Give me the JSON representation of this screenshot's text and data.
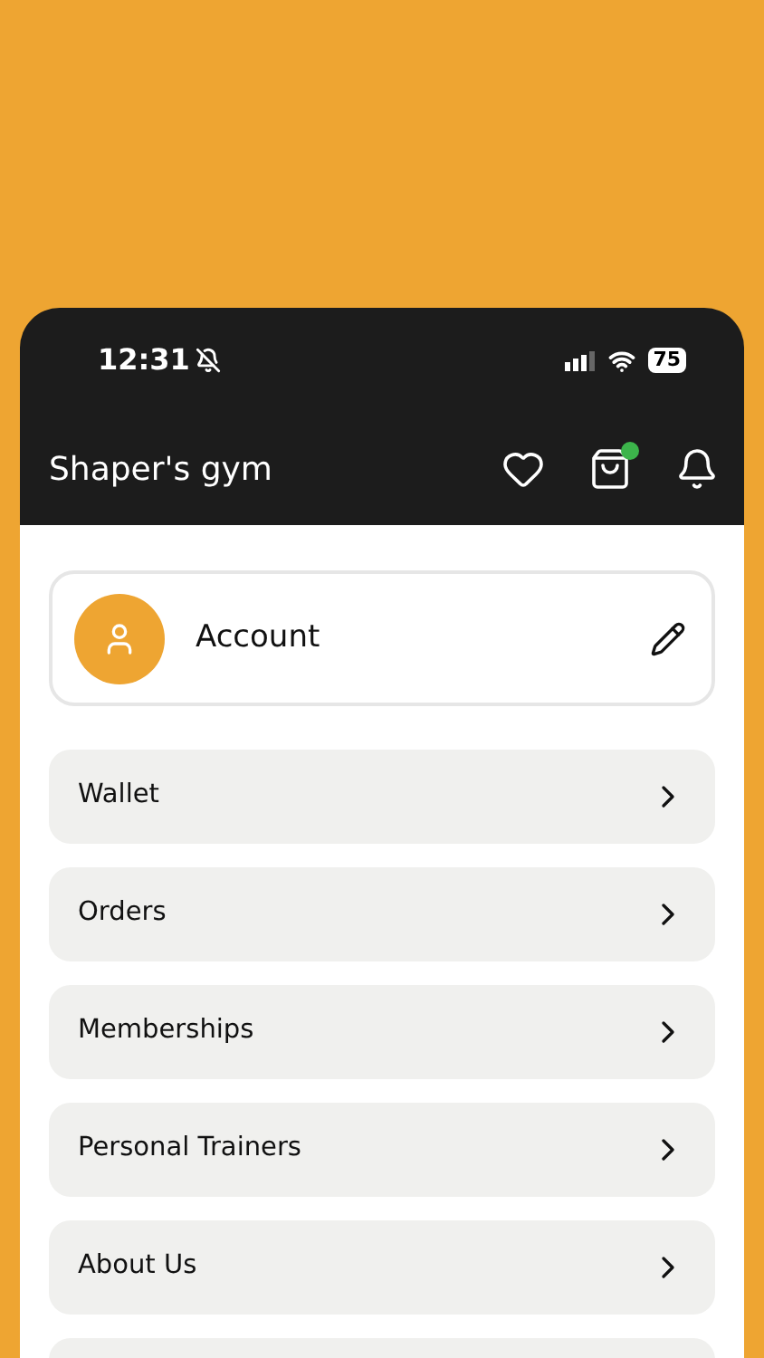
{
  "status_bar": {
    "time": "12:31",
    "battery": "75"
  },
  "header": {
    "title": "Shaper's gym",
    "cart_badge": true
  },
  "account": {
    "label": "Account"
  },
  "menu": [
    {
      "label": "Wallet"
    },
    {
      "label": "Orders"
    },
    {
      "label": "Memberships"
    },
    {
      "label": "Personal Trainers"
    },
    {
      "label": "About Us"
    }
  ]
}
